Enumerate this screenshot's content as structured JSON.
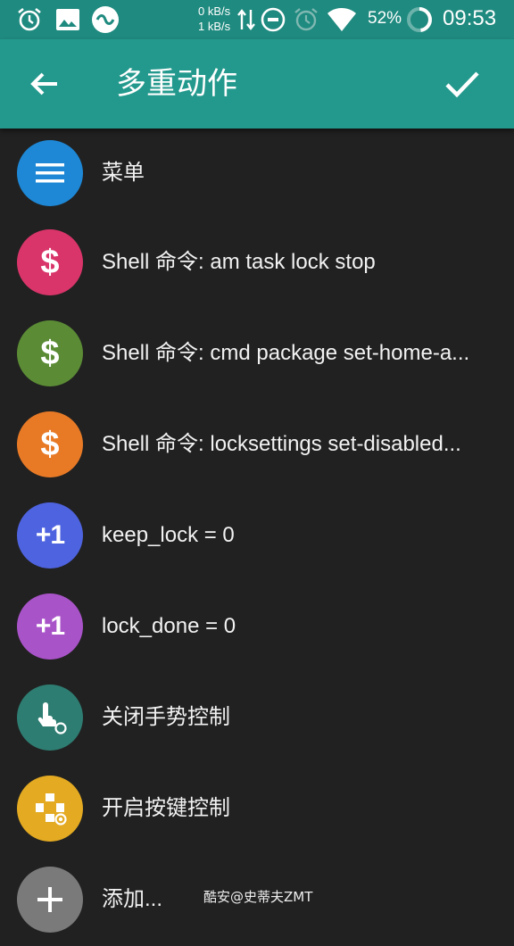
{
  "status_bar": {
    "net_up": "0 kB/s",
    "net_down": "1 kB/s",
    "battery": "52%",
    "time": "09:53"
  },
  "app_bar": {
    "title": "多重动作"
  },
  "items": [
    {
      "label": "菜单",
      "icon": "menu-icon",
      "color": "#1e88d6"
    },
    {
      "label": "Shell 命令: am task lock stop",
      "icon": "dollar-icon",
      "color": "#d9356a"
    },
    {
      "label": "Shell 命令: cmd package set-home-a...",
      "icon": "dollar-icon",
      "color": "#5b8c35"
    },
    {
      "label": "Shell 命令: locksettings set-disabled...",
      "icon": "dollar-icon",
      "color": "#e87a26"
    },
    {
      "label": "keep_lock = 0",
      "icon": "plus-one-icon",
      "glyph": "+1",
      "color": "#4e63df"
    },
    {
      "label": "lock_done = 0",
      "icon": "plus-one-icon",
      "glyph": "+1",
      "color": "#a953c9"
    },
    {
      "label": "关闭手势控制",
      "icon": "touch-gesture-icon",
      "color": "#2e7d72"
    },
    {
      "label": "开启按键控制",
      "icon": "gamepad-icon",
      "color": "#e3aa22"
    },
    {
      "label": "添加...",
      "icon": "plus-icon",
      "color": "#7a7a7a"
    }
  ],
  "watermark": "酷安@史蒂夫ZMT"
}
